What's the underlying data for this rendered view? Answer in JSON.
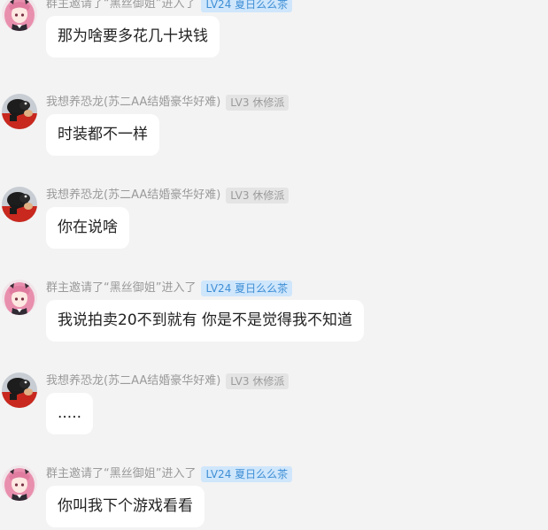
{
  "messages": [
    {
      "avatar": "pink-haired-girl-avatar",
      "sender": "群主邀请了“黑丝御姐”进入了",
      "badge": "LV24 夏日么么茶",
      "badge_style": "blue",
      "text": "那为啥要多花几十块钱"
    },
    {
      "avatar": "dinosaur-avatar",
      "sender": "我想养恐龙(苏二AA结婚豪华好难)",
      "badge": "LV3 休修派",
      "badge_style": "gray",
      "text": "时装都不一样"
    },
    {
      "avatar": "dinosaur-avatar",
      "sender": "我想养恐龙(苏二AA结婚豪华好难)",
      "badge": "LV3 休修派",
      "badge_style": "gray",
      "text": "你在说啥"
    },
    {
      "avatar": "pink-haired-girl-avatar",
      "sender": "群主邀请了“黑丝御姐”进入了",
      "badge": "LV24 夏日么么茶",
      "badge_style": "blue",
      "text": "我说拍卖20不到就有 你是不是觉得我不知道"
    },
    {
      "avatar": "dinosaur-avatar",
      "sender": "我想养恐龙(苏二AA结婚豪华好难)",
      "badge": "LV3 休修派",
      "badge_style": "gray",
      "text": "....."
    },
    {
      "avatar": "pink-haired-girl-avatar",
      "sender": "群主邀请了“黑丝御姐”进入了",
      "badge": "LV24 夏日么么茶",
      "badge_style": "blue",
      "text": "你叫我下个游戏看看"
    }
  ],
  "colors": {
    "background": "#f3f3f3",
    "bubble": "#ffffff",
    "badge_blue_bg": "#cfe6fb",
    "badge_blue_text": "#3f8fd6",
    "badge_gray_bg": "#e4e4e4",
    "badge_gray_text": "#9b9b9b",
    "sender_text": "#9a9a9a"
  }
}
